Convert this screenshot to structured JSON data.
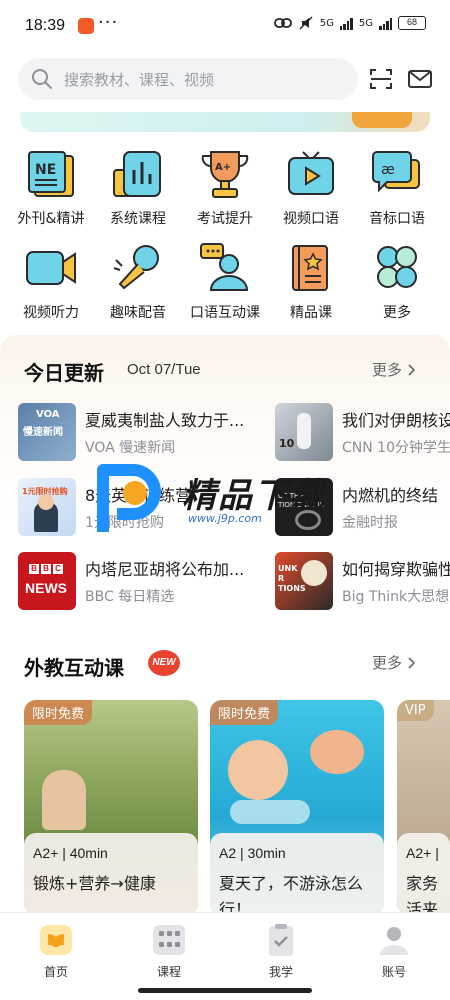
{
  "status_bar": {
    "time": "18:39",
    "dots": "···",
    "network_1": "5G",
    "network_2": "5G",
    "battery": "68"
  },
  "search": {
    "placeholder": "搜索教材、课程、视频"
  },
  "categories": [
    {
      "label": "外刊&精讲",
      "icon": "magazine-icon"
    },
    {
      "label": "系统课程",
      "icon": "bar-chart-icon"
    },
    {
      "label": "考试提升",
      "icon": "trophy-icon"
    },
    {
      "label": "视频口语",
      "icon": "tv-play-icon"
    },
    {
      "label": "音标口语",
      "icon": "phonetic-chat-icon"
    },
    {
      "label": "视频听力",
      "icon": "video-camera-icon"
    },
    {
      "label": "趣味配音",
      "icon": "microphone-icon"
    },
    {
      "label": "口语互动课",
      "icon": "person-chat-icon"
    },
    {
      "label": "精品课",
      "icon": "star-book-icon"
    },
    {
      "label": "更多",
      "icon": "clover-more-icon"
    }
  ],
  "today": {
    "title": "今日更新",
    "date": "Oct 07/Tue",
    "more": "更多",
    "items": [
      {
        "title": "夏威夷制盐人致力于...",
        "source": "VOA 慢速新闻",
        "thumb_text": "VOA\n慢速新闻"
      },
      {
        "title": "我们对伊朗核设",
        "source": "CNN 10分钟学生",
        "thumb_text": ""
      },
      {
        "title": "8天英语训练营",
        "source": "1元限时抢购",
        "thumb_text": "1元限时抢购"
      },
      {
        "title": "内燃机的终结",
        "source": "金融时报",
        "thumb_text": "OF THE\nTION ENGINE"
      },
      {
        "title": "内塔尼亚胡将公布加...",
        "source": "BBC 每日精选",
        "thumb_text": "BBC\nNEWS"
      },
      {
        "title": "如何揭穿欺骗性",
        "source": "Big Think大思想",
        "thumb_text": "UNK\nR\nTIONS"
      }
    ]
  },
  "watermark": {
    "text": "精品下载",
    "url": "www.j9p.com"
  },
  "foreign": {
    "title": "外教互动课",
    "badge": "NEW",
    "more": "更多",
    "cards": [
      {
        "tag": "限时免费",
        "meta": "A2+ | 40min",
        "title": "锻炼+营养→健康"
      },
      {
        "tag": "限时免费",
        "meta": "A2 | 30min",
        "title": "夏天了，不游泳怎么行！"
      },
      {
        "tag": "VIP",
        "meta": "A2+ |",
        "title": "家务活来干?"
      }
    ]
  },
  "nav": [
    {
      "label": "首页",
      "icon": "home-book-icon"
    },
    {
      "label": "课程",
      "icon": "grid-course-icon"
    },
    {
      "label": "我学",
      "icon": "clipboard-check-icon"
    },
    {
      "label": "账号",
      "icon": "account-person-icon"
    }
  ]
}
